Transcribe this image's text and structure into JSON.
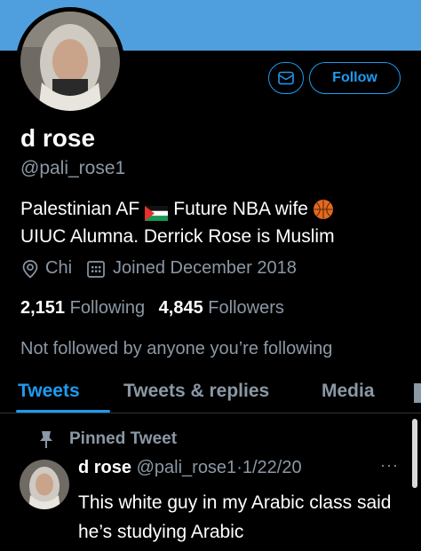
{
  "profile": {
    "name": "d rose",
    "handle": "@pali_rose1",
    "bio_line1_a": "Palestinian AF",
    "bio_line1_b": "Future NBA wife",
    "bio_line2": "UIUC Alumna. Derrick Rose is Muslim",
    "location": "Chi",
    "joined": "Joined December 2018",
    "following_count": "2,151",
    "following_label": "Following",
    "followers_count": "4,845",
    "followers_label": "Followers",
    "not_followed": "Not followed by anyone you’re following"
  },
  "actions": {
    "follow_label": "Follow",
    "message_icon": "envelope-icon"
  },
  "tabs": [
    {
      "label": "Tweets",
      "active": true
    },
    {
      "label": "Tweets & replies",
      "active": false
    },
    {
      "label": "Media",
      "active": false
    }
  ],
  "pinned": {
    "label": "Pinned Tweet",
    "name": "d rose",
    "handle": "@pali_rose1",
    "date": "·1/22/20",
    "text": "This white guy in my Arabic class said he’s studying Arabic",
    "more": "···"
  },
  "colors": {
    "banner": "#4f9fde",
    "accent": "#1d9bf0",
    "background": "#000000",
    "secondary_text": "#8b98a5"
  }
}
